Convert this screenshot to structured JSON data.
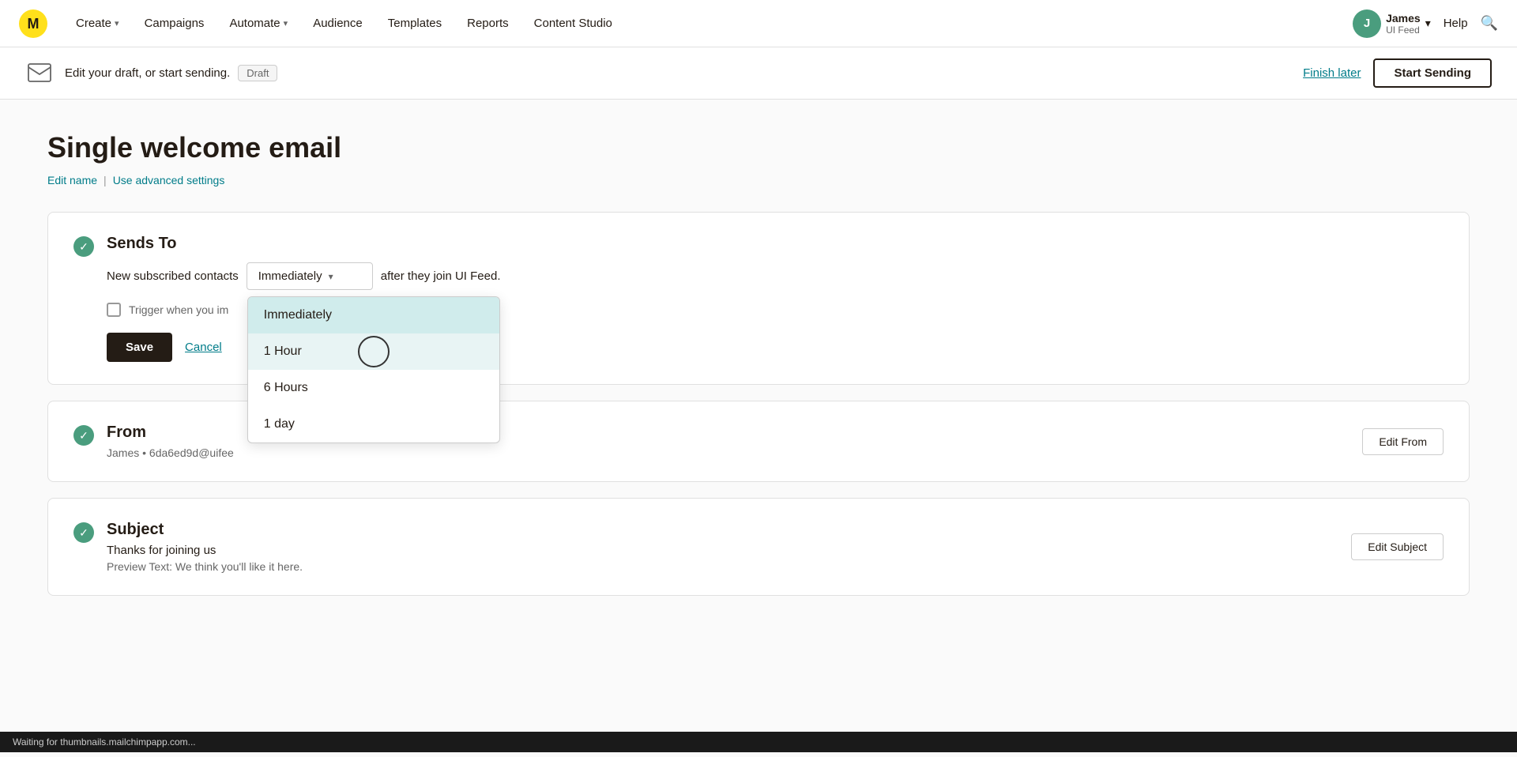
{
  "nav": {
    "logo_alt": "Mailchimp",
    "items": [
      {
        "id": "create",
        "label": "Create",
        "has_chevron": true
      },
      {
        "id": "campaigns",
        "label": "Campaigns",
        "has_chevron": false
      },
      {
        "id": "automate",
        "label": "Automate",
        "has_chevron": true
      },
      {
        "id": "audience",
        "label": "Audience",
        "has_chevron": false
      },
      {
        "id": "templates",
        "label": "Templates",
        "has_chevron": false
      },
      {
        "id": "reports",
        "label": "Reports",
        "has_chevron": false
      },
      {
        "id": "content_studio",
        "label": "Content Studio",
        "has_chevron": false
      }
    ],
    "user": {
      "initial": "J",
      "name": "James",
      "sub": "UI Feed",
      "has_chevron": true
    },
    "help_label": "Help"
  },
  "draft_bar": {
    "text": "Edit your draft, or start sending.",
    "badge": "Draft",
    "finish_later": "Finish later",
    "start_sending": "Start Sending"
  },
  "page": {
    "title": "Single welcome email",
    "edit_name": "Edit name",
    "use_advanced": "Use advanced settings"
  },
  "sends_to": {
    "section_title": "Sends To",
    "prefix_label": "New subscribed contacts",
    "dropdown_value": "Immediately",
    "suffix_label": "after they join UI Feed.",
    "trigger_label": "Trigger when you im",
    "dropdown_options": [
      {
        "id": "immediately",
        "label": "Immediately",
        "selected": true,
        "hovered": false
      },
      {
        "id": "1hour",
        "label": "1 Hour",
        "selected": false,
        "hovered": true
      },
      {
        "id": "6hours",
        "label": "6 Hours",
        "selected": false,
        "hovered": false
      },
      {
        "id": "1day",
        "label": "1 day",
        "selected": false,
        "hovered": false
      }
    ],
    "save_label": "Save",
    "cancel_label": "Cancel"
  },
  "from_section": {
    "title": "From",
    "value": "James • 6da6ed9d@uifee",
    "edit_label": "Edit From"
  },
  "subject_section": {
    "title": "Subject",
    "subject_text": "Thanks for joining us",
    "preview_text": "Preview Text: We think you'll like it here.",
    "edit_label": "Edit Subject"
  },
  "status_bar": {
    "text": "Waiting for thumbnails.mailchimpapp.com..."
  }
}
